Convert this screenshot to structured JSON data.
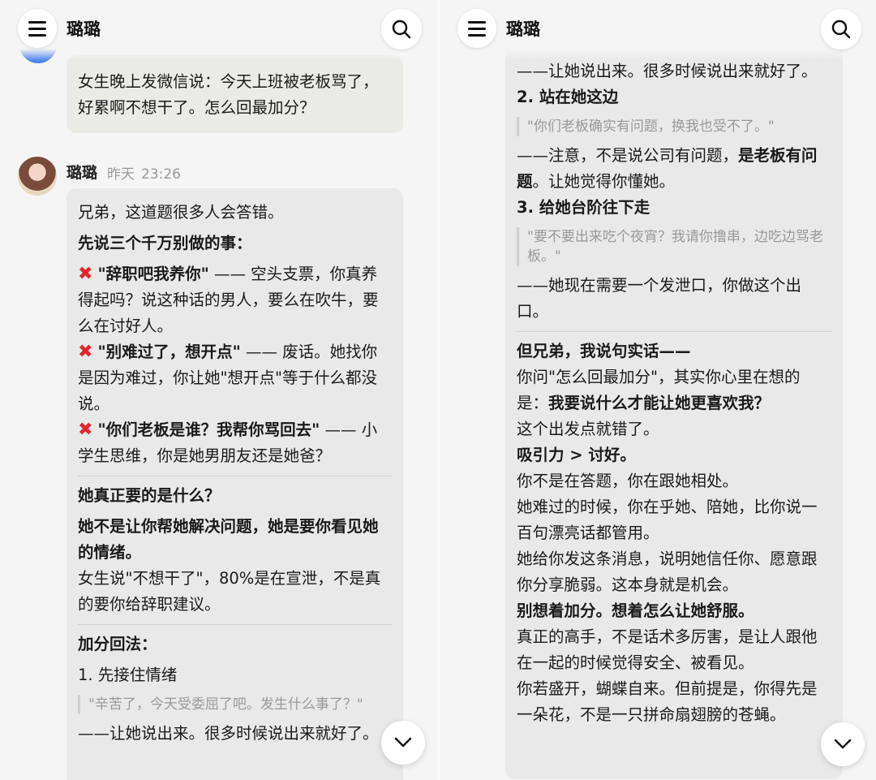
{
  "header": {
    "title": "璐璐"
  },
  "left": {
    "user_message": "女生晚上发微信说：今天上班被老板骂了，好累啊不想干了。怎么回最加分？",
    "sender": {
      "name": "璐璐",
      "day": "昨天",
      "time": "23:26"
    },
    "intro": "兄弟，这道题很多人会答错。",
    "donts_title": "先说三个千万别做的事：",
    "donts": [
      {
        "quote": "\"辞职吧我养你\"",
        "dash": " —— ",
        "text": "空头支票，你真养得起吗？说这种话的男人，要么在吹牛，要么在讨好人。"
      },
      {
        "quote": "\"别难过了，想开点\"",
        "dash": " —— ",
        "text": "废话。她找你是因为难过，你让她\"想开点\"等于什么都没说。"
      },
      {
        "quote": "\"你们老板是谁？我帮你骂回去\"",
        "dash": " —— ",
        "text": "小学生思维，你是她男朋友还是她爸？"
      }
    ],
    "need_title": "她真正要的是什么？",
    "need_bold": "她不是让你帮她解决问题，她是要你看见她的情绪。",
    "need_text": "女生说\"不想干了\"，80%是在宣泄，不是真的要你给辞职建议。",
    "plus_title": "加分回法：",
    "step1_title": "1. 先接住情绪",
    "step1_quote": "\"辛苦了，今天受委屈了吧。发生什么事了？\"",
    "step1_text": "——让她说出来。很多时候说出来就好了。"
  },
  "right": {
    "step1_text": "——让她说出来。很多时候说出来就好了。",
    "step2_title": "2. 站在她这边",
    "step2_quote": "\"你们老板确实有问题，换我也受不了。\"",
    "step2_text_a": "——注意，不是说公司有问题，",
    "step2_text_b": "是老板有问题",
    "step2_text_c": "。让她觉得你懂她。",
    "step3_title": "3. 给她台阶往下走",
    "step3_quote": "\"要不要出来吃个夜宵？我请你撸串，边吃边骂老板。\"",
    "step3_text": "——她现在需要一个发泄口，你做这个出口。",
    "truth_title": "但兄弟，我说句实话——",
    "truth_a": "你问\"怎么回最加分\"，其实你心里在想的是：",
    "truth_b": "我要说什么才能让她更喜欢我？",
    "truth_c": "这个出发点就错了。",
    "attract": "吸引力 > 讨好。",
    "line1": "你不是在答题，你在跟她相处。",
    "line2": "她难过的时候，你在乎她、陪她，比你说一百句漂亮话都管用。",
    "line3": "她给你发这条消息，说明她信任你、愿意跟你分享脆弱。这本身就是机会。",
    "line4": "别想着加分。想着怎么让她舒服。",
    "line5": "真正的高手，不是话术多厉害，是让人跟他在一起的时候觉得安全、被看见。",
    "line6": "你若盛开，蝴蝶自来。但前提是，你得先是一朵花，不是一只拼命扇翅膀的苍蝇。"
  }
}
